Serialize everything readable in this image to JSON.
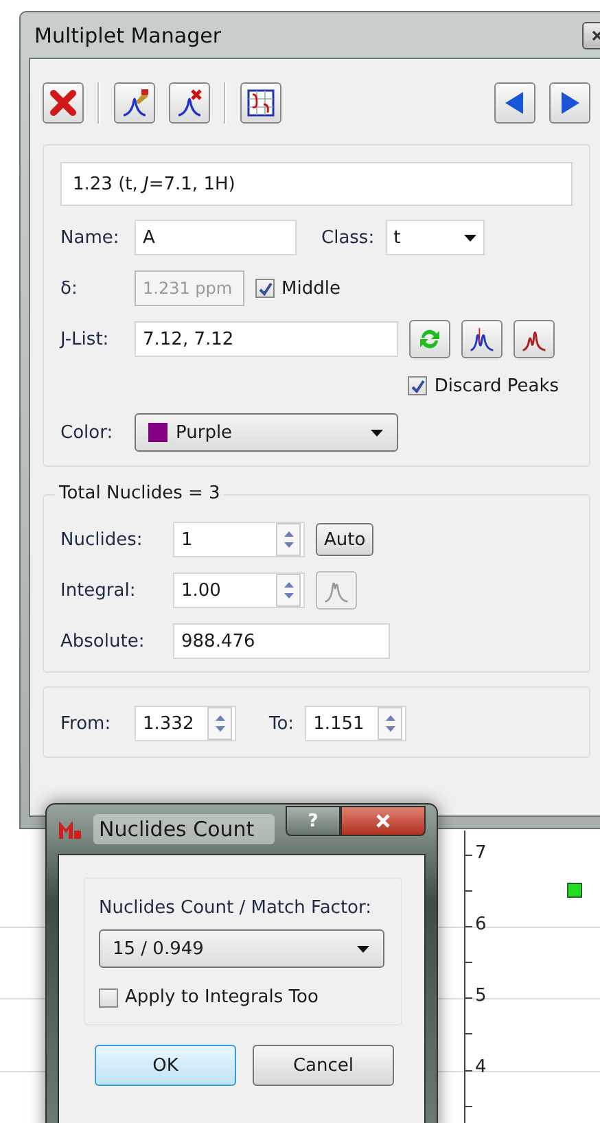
{
  "window": {
    "title": "Multiplet Manager"
  },
  "toolbar": [
    {
      "kind": "delete"
    },
    {
      "kind": "separator"
    },
    {
      "kind": "edit-peak"
    },
    {
      "kind": "delete-peak"
    },
    {
      "kind": "separator"
    },
    {
      "kind": "j-table"
    },
    {
      "kind": "spacer"
    },
    {
      "kind": "previous"
    },
    {
      "kind": "next"
    }
  ],
  "summary": "1.23 (t, *J*=7.1, 1H)",
  "name": {
    "label": "Name:",
    "value": "A"
  },
  "class": {
    "label": "Class:",
    "value": "t"
  },
  "shift": {
    "label": "δ:",
    "value": "1.231 ppm",
    "disabled": true
  },
  "middle": {
    "label": "Middle",
    "checked": true
  },
  "jlist": {
    "label": "J-List:",
    "value": "7.12, 7.12"
  },
  "jlist_buttons": [
    {
      "kind": "refresh"
    },
    {
      "kind": "fit-peaks"
    },
    {
      "kind": "show-peaks"
    }
  ],
  "discard_peaks": {
    "label": "Discard Peaks",
    "checked": true
  },
  "color": {
    "label": "Color:",
    "value": "Purple",
    "color": "#800080"
  },
  "nuclides_group": {
    "title": "Total Nuclides = 3",
    "nuclides": {
      "label": "Nuclides:",
      "value": "1"
    },
    "auto_button": "Auto",
    "integral": {
      "label": "Integral:",
      "value": "1.00"
    },
    "integral_button": {
      "disabled": true
    },
    "absolute": {
      "label": "Absolute:",
      "value": "988.476"
    }
  },
  "range": {
    "from": {
      "label": "From:",
      "value": "1.332"
    },
    "to": {
      "label": "To:",
      "value": "1.151"
    }
  },
  "plot": {
    "tick_labels": [
      "7",
      "6",
      "5",
      "4"
    ]
  },
  "dialog": {
    "title": "Nuclides Count",
    "help": "?",
    "field_label": "Nuclides Count / Match Factor:",
    "selection": "15 / 0.949",
    "apply_integrals": {
      "label": "Apply to Integrals Too",
      "checked": false
    },
    "buttons": [
      {
        "label": "OK",
        "default": true
      },
      {
        "label": "Cancel",
        "default": false
      }
    ]
  }
}
